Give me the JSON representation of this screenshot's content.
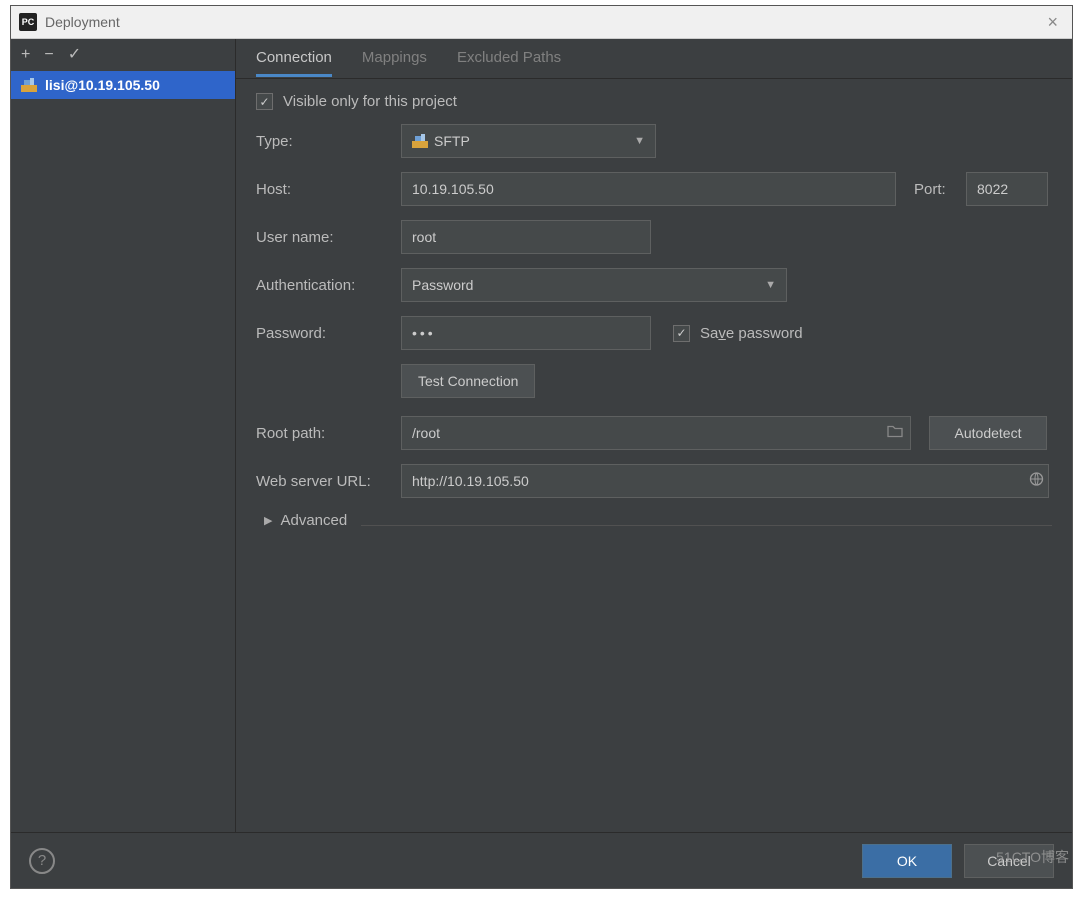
{
  "window": {
    "title": "Deployment"
  },
  "sidebar": {
    "items": [
      {
        "label": "lisi@10.19.105.50"
      }
    ]
  },
  "tabs": {
    "connection": "Connection",
    "mappings": "Mappings",
    "excluded": "Excluded Paths"
  },
  "form": {
    "visible_only_label": "Visible only for this project",
    "visible_only_checked": true,
    "type_label": "Type:",
    "type_value": "SFTP",
    "host_label": "Host:",
    "host_value": "10.19.105.50",
    "port_label": "Port:",
    "port_value": "8022",
    "user_label": "User name:",
    "user_value": "root",
    "auth_label": "Authentication:",
    "auth_value": "Password",
    "password_label": "Password:",
    "password_value": "•••",
    "save_password_pre": "Sa",
    "save_password_u": "v",
    "save_password_post": "e password",
    "save_password_checked": true,
    "test_connection": "Test Connection",
    "root_path_label": "Root path:",
    "root_path_value": "/root",
    "autodetect": "Autodetect",
    "web_url_label": "Web server URL:",
    "web_url_value": "http://10.19.105.50",
    "advanced": "Advanced"
  },
  "footer": {
    "ok": "OK",
    "cancel": "Cancel"
  },
  "watermark": "51CTO博客"
}
